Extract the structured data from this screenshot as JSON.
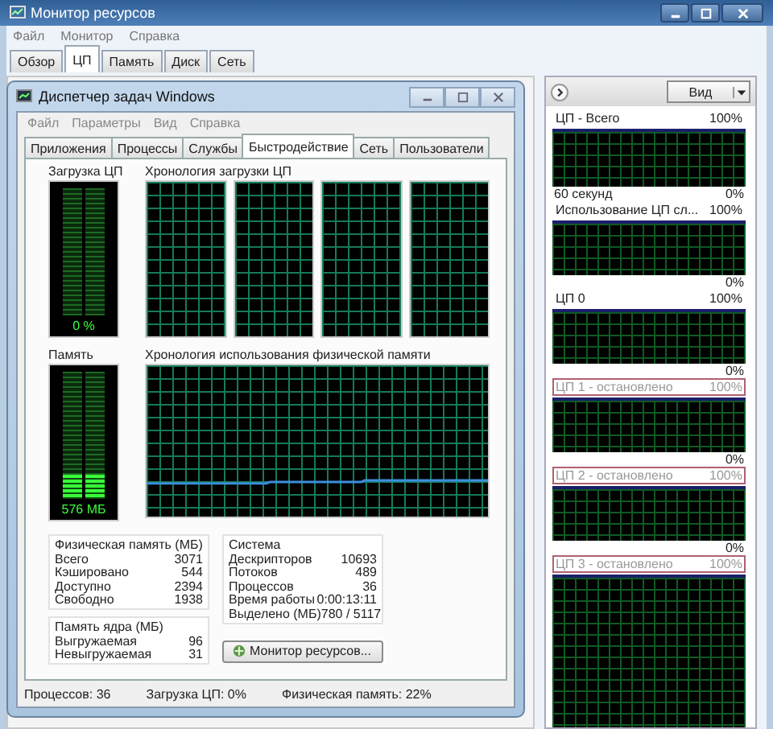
{
  "monitor": {
    "title": "Монитор ресурсов",
    "menu": [
      "Файл",
      "Монитор",
      "Справка"
    ],
    "tabs": [
      {
        "label": "Обзор",
        "selected": false
      },
      {
        "label": "ЦП",
        "selected": true
      },
      {
        "label": "Память",
        "selected": false
      },
      {
        "label": "Диск",
        "selected": false
      },
      {
        "label": "Сеть",
        "selected": false
      }
    ],
    "view_button": "Вид",
    "graphs": [
      {
        "title": "ЦП - Всего",
        "max": "100%",
        "time": "60 секунд",
        "min": "0%",
        "stopped": false
      },
      {
        "title": "Использование ЦП сл...",
        "max": "100%",
        "min": "0%",
        "stopped": false
      },
      {
        "title": "ЦП 0",
        "max": "100%",
        "min": "0%",
        "stopped": false
      },
      {
        "title": "ЦП 1 - остановлено",
        "max": "100%",
        "min": "0%",
        "stopped": true
      },
      {
        "title": "ЦП 2 - остановлено",
        "max": "100%",
        "min": "0%",
        "stopped": true
      },
      {
        "title": "ЦП 3 - остановлено",
        "max": "100%",
        "stopped": true
      }
    ]
  },
  "task_manager": {
    "title": "Диспетчер задач Windows",
    "menu": [
      "Файл",
      "Параметры",
      "Вид",
      "Справка"
    ],
    "tabs": [
      {
        "label": "Приложения",
        "selected": false
      },
      {
        "label": "Процессы",
        "selected": false
      },
      {
        "label": "Службы",
        "selected": false
      },
      {
        "label": "Быстродействие",
        "selected": true
      },
      {
        "label": "Сеть",
        "selected": false
      },
      {
        "label": "Пользователи",
        "selected": false
      }
    ],
    "cpu_meter": {
      "label": "Загрузка ЦП",
      "level": 0,
      "reading": "0 %"
    },
    "cpu_history": {
      "label": "Хронология загрузки ЦП",
      "panels": [
        {
          "kind": "graph"
        },
        {
          "kind": "graph"
        },
        {
          "kind": "graph"
        },
        {
          "kind": "graph"
        }
      ]
    },
    "memory_meter": {
      "label": "Память",
      "level": 0.19,
      "reading": "576 МБ"
    },
    "memory_history": {
      "label": "Хронология использования физической памяти"
    },
    "physical_memory": {
      "title": "Физическая память (МБ)",
      "rows": [
        {
          "label": "Всего",
          "value": "3071"
        },
        {
          "label": "Кэшировано",
          "value": "544"
        },
        {
          "label": "Доступно",
          "value": "2394"
        },
        {
          "label": "Свободно",
          "value": "1938"
        }
      ]
    },
    "system": {
      "title": "Система",
      "rows": [
        {
          "label": "Дескрипторов",
          "value": "10693"
        },
        {
          "label": "Потоков",
          "value": "489"
        },
        {
          "label": "Процессов",
          "value": "36"
        },
        {
          "label": "Время работы",
          "value": "0:00:13:11"
        },
        {
          "label": "Выделено (МБ)",
          "value": "780 / 5117"
        }
      ]
    },
    "kernel_memory": {
      "title": "Память ядра (МБ)",
      "rows": [
        {
          "label": "Выгружаемая",
          "value": "96"
        },
        {
          "label": "Невыгружаемая",
          "value": "31"
        }
      ]
    },
    "button": "Монитор ресурсов...",
    "status": [
      "Процессов: 36",
      "Загрузка ЦП: 0%",
      "Физическая память: 22%"
    ]
  }
}
